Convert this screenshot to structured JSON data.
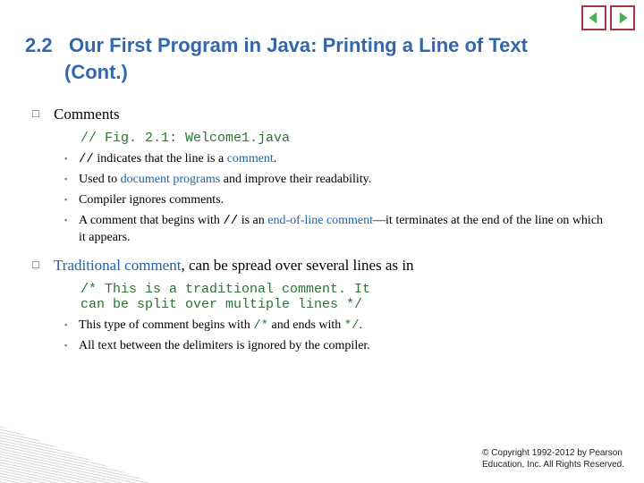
{
  "nav": {
    "prev": "previous-slide",
    "next": "next-slide"
  },
  "heading": {
    "number": "2.2",
    "title_line1": "Our First Program in Java: Printing a Line of Text",
    "title_line2": "(Cont.)"
  },
  "section1": {
    "title": "Comments",
    "code": "// Fig. 2.1: Welcome1.java",
    "items": [
      {
        "pre": "",
        "mono1": "//",
        "mid": " indicates that the line is a ",
        "kw": "comment",
        "post": "."
      },
      {
        "pre": "Used to ",
        "kw": "document programs",
        "post": " and improve their readability."
      },
      {
        "pre": "Compiler ignores comments.",
        "kw": "",
        "post": ""
      },
      {
        "pre": "A comment that begins with ",
        "mono1": "//",
        "mid": " is an ",
        "kw": "end-of-line comment",
        "post": "—it terminates at the end of the line on which it appears."
      }
    ]
  },
  "section2": {
    "title_kw": "Traditional comment",
    "title_rest": ", can be spread over several lines as in",
    "code_lines": [
      "/* This is a traditional comment. It",
      "   can be split over multiple lines */"
    ],
    "items": [
      {
        "pre": "This type of comment begins with ",
        "mono1": "/*",
        "mid": " and ends with ",
        "mono2": "*/",
        "post": "."
      },
      {
        "pre": "All text between the delimiters is ignored by the compiler.",
        "mono1": "",
        "mid": "",
        "mono2": "",
        "post": ""
      }
    ]
  },
  "footer": {
    "line1": "© Copyright 1992-2012 by Pearson",
    "line2": "Education, Inc. All Rights Reserved."
  }
}
